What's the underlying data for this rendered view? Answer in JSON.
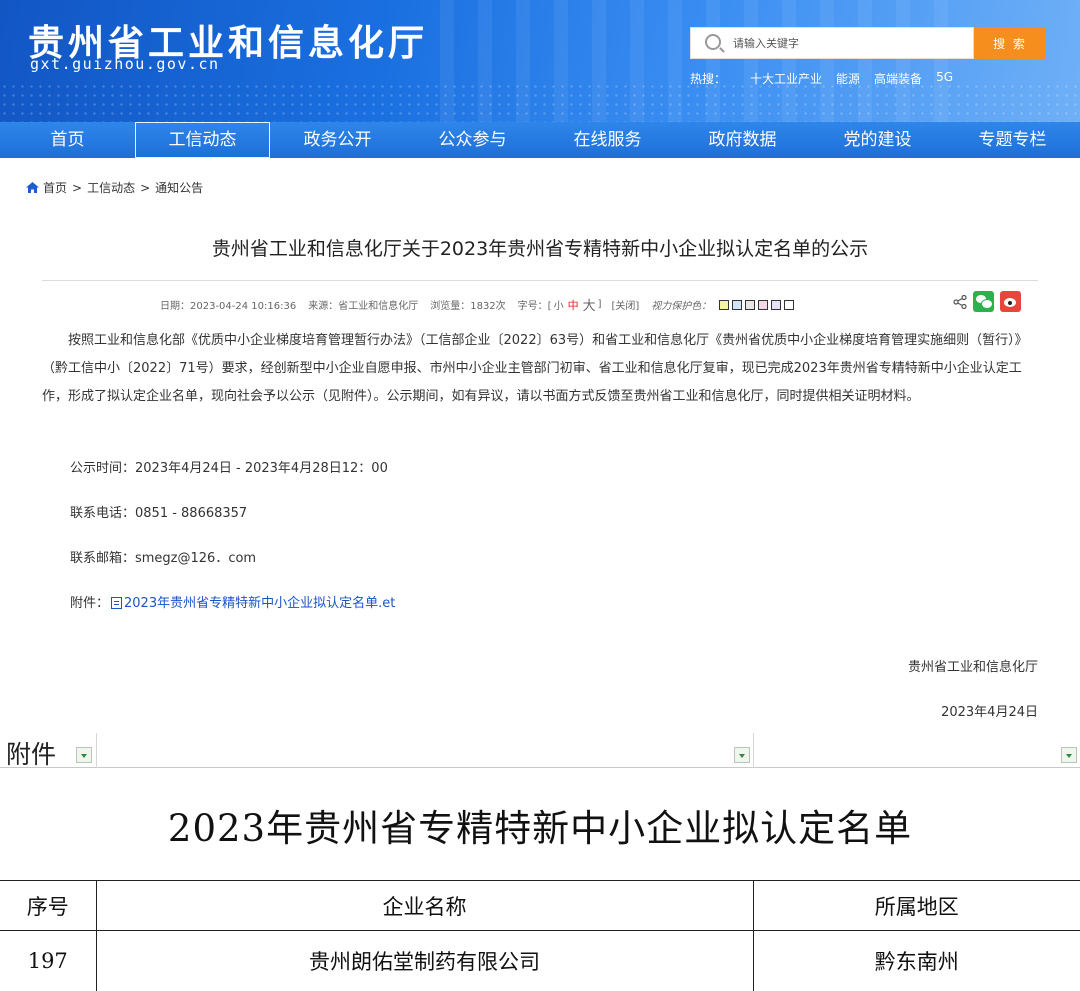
{
  "site": {
    "title": "贵州省工业和信息化厅",
    "domain": "gxt.guizhou.gov.cn"
  },
  "search": {
    "placeholder": "请输入关键字",
    "button_label": "搜 索",
    "hot_label": "热搜：",
    "hot_terms": [
      "十大工业产业",
      "能源",
      "高端装备",
      "5G"
    ]
  },
  "nav": {
    "items": [
      "首页",
      "工信动态",
      "政务公开",
      "公众参与",
      "在线服务",
      "政府数据",
      "党的建设",
      "专题专栏"
    ],
    "active": "工信动态"
  },
  "breadcrumb": {
    "home": "首页",
    "separator": ">",
    "level1": "工信动态",
    "level2": "通知公告"
  },
  "article": {
    "title": "贵州省工业和信息化厅关于2023年贵州省专精特新中小企业拟认定名单的公示",
    "meta": {
      "date": "日期：2023-04-24 10:16:36",
      "source": "来源：省工业和信息化厅",
      "views": "浏览量：1832次",
      "font_size_label": "字号：[",
      "font_small": "小",
      "font_mid": "中",
      "font_big": "大",
      "font_end": "]",
      "close_label": "[关闭]",
      "protect_label": "视力保护色：",
      "swatch_colors": [
        "#f6f2a8",
        "#cfe6f7",
        "#e6e6e6",
        "#f2d8e6",
        "#e8e0f4",
        "#ffffff"
      ]
    },
    "body": "按照工业和信息化部《优质中小企业梯度培育管理暂行办法》（工信部企业〔2022〕63号）和省工业和信息化厅《贵州省优质中小企业梯度培育管理实施细则（暂行）》（黔工信中小〔2022〕71号）要求，经创新型中小企业自愿申报、市州中小企业主管部门初审、省工业和信息化厅复审，现已完成2023年贵州省专精特新中小企业认定工作，形成了拟认定企业名单，现向社会予以公示（见附件）。公示期间，如有异议，请以书面方式反馈至贵州省工业和信息化厅，同时提供相关证明材料。",
    "notice_period": "公示时间：2023年4月24日 - 2023年4月28日12：00",
    "phone": "联系电话：0851 - 88668357",
    "email": "联系邮箱：smegz@126．com",
    "attachment_label": "附件：",
    "attachment_name": "2023年贵州省专精特新中小企业拟认定名单.et",
    "signature": "贵州省工业和信息化厅",
    "sign_date": "2023年4月24日"
  },
  "sheet": {
    "label": "附件",
    "title": "2023年贵州省专精特新中小企业拟认定名单",
    "headers": [
      "序号",
      "企业名称",
      "所属地区"
    ],
    "rows": [
      [
        "197",
        "贵州朗佑堂制药有限公司",
        "黔东南州"
      ]
    ]
  }
}
